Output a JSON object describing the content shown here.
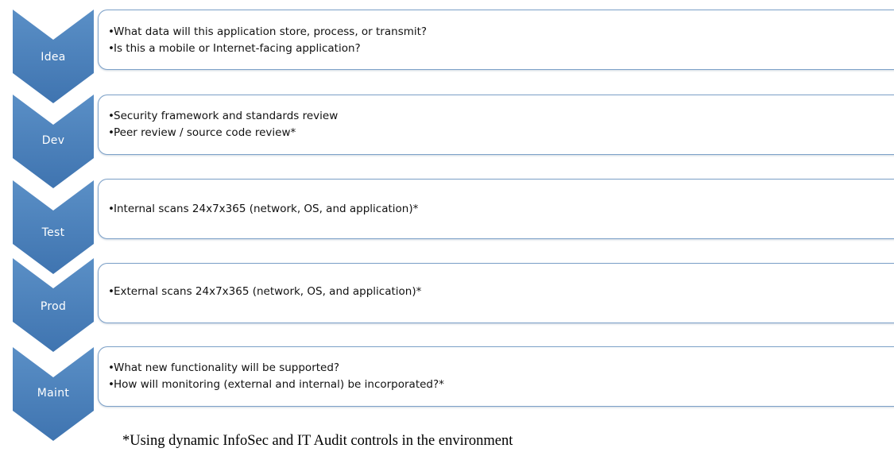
{
  "diagram": {
    "steps": [
      {
        "label": "Idea",
        "items": [
          "What data will this application store, process, or transmit?",
          "Is this a mobile or Internet-facing application?"
        ]
      },
      {
        "label": "Dev",
        "items": [
          "Security framework and standards review",
          "Peer review / source code review*"
        ]
      },
      {
        "label": "Test",
        "items": [
          "Internal scans 24x7x365 (network, OS, and application)*"
        ]
      },
      {
        "label": "Prod",
        "items": [
          "External scans 24x7x365 (network, OS, and application)*"
        ]
      },
      {
        "label": "Maint",
        "items": [
          "What new functionality will be supported?",
          "How will monitoring (external and internal) be incorporated?*"
        ]
      }
    ],
    "bullet_char": "•",
    "footnote": "*Using dynamic InfoSec and IT Audit controls in the environment",
    "colors": {
      "chevron_top": "#5a8fc6",
      "chevron_bottom": "#3f74b0",
      "box_border": "#7da1c8"
    }
  }
}
